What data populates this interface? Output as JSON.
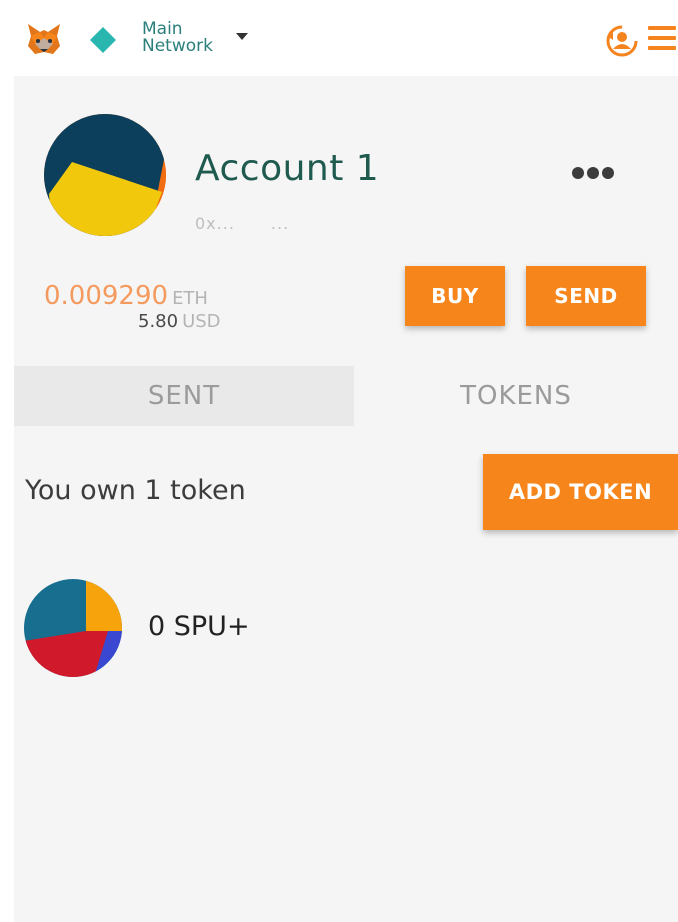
{
  "header": {
    "network_line1": "Main",
    "network_line2": "Network",
    "logo_icon": "metamask-fox-icon",
    "network_icon": "network-diamond-icon",
    "account_icon": "account-switch-icon",
    "menu_icon": "hamburger-menu-icon"
  },
  "account": {
    "name": "Account 1",
    "address_prefix": "0x...",
    "address_suffix": "...",
    "avatar_icon": "identicon-avatar"
  },
  "balance": {
    "eth_value": "0.009290",
    "eth_unit": "ETH",
    "usd_value": "5.80",
    "usd_unit": "USD"
  },
  "actions": {
    "buy_label": "BUY",
    "send_label": "SEND"
  },
  "tabs": [
    {
      "label": "SENT",
      "active": false
    },
    {
      "label": "TOKENS",
      "active": true
    }
  ],
  "tokens_panel": {
    "summary": "You own 1 token",
    "add_label": "ADD TOKEN",
    "items": [
      {
        "amount": "0 SPU+",
        "icon": "token-identicon"
      }
    ]
  },
  "colors": {
    "accent": "#f6851b",
    "account_name": "#1f5a4e",
    "network_text": "#2a7f7a",
    "balance_eth": "#f59a5e"
  }
}
